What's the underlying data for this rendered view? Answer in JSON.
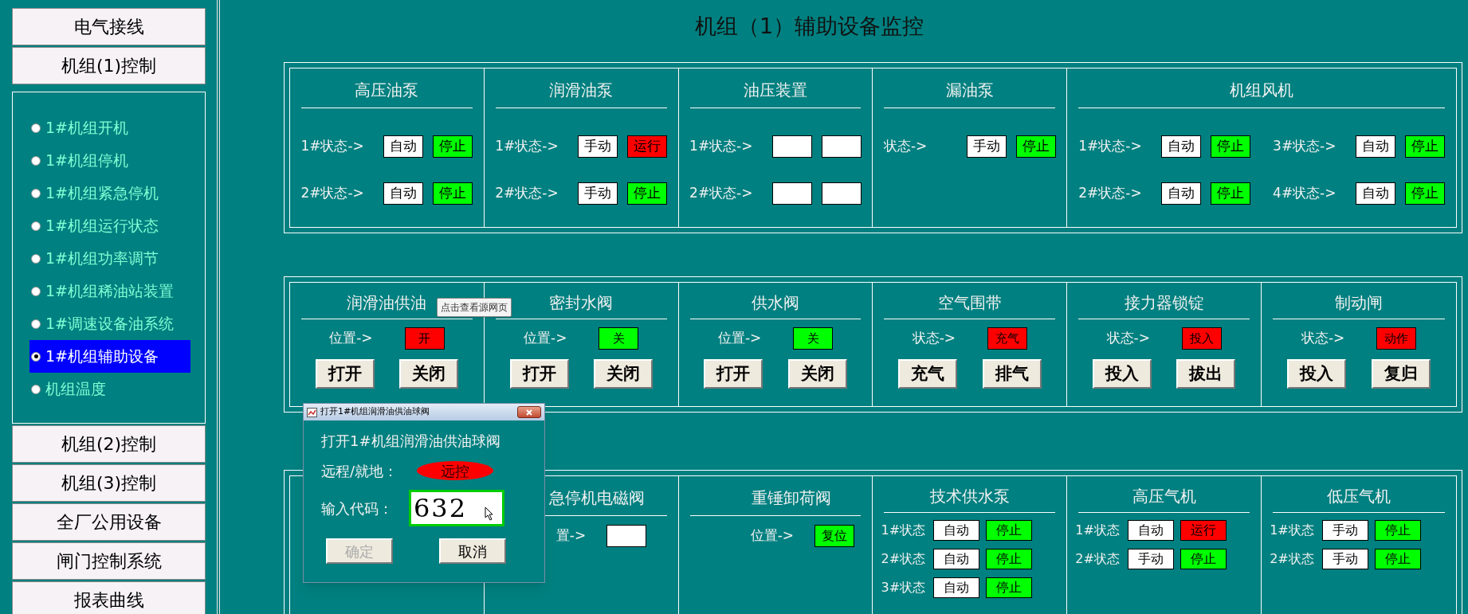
{
  "sidebar": {
    "top_buttons": [
      "电气接线",
      "机组(1)控制"
    ],
    "items": [
      {
        "label": "1#机组开机",
        "selected": false
      },
      {
        "label": "1#机组停机",
        "selected": false
      },
      {
        "label": "1#机组紧急停机",
        "selected": false
      },
      {
        "label": "1#机组运行状态",
        "selected": false
      },
      {
        "label": "1#机组功率调节",
        "selected": false
      },
      {
        "label": "1#机组稀油站装置",
        "selected": false
      },
      {
        "label": "1#调速设备油系统",
        "selected": false
      },
      {
        "label": "1#机组辅助设备",
        "selected": true
      },
      {
        "label": "机组温度",
        "selected": false
      }
    ],
    "bottom_buttons": [
      "机组(2)控制",
      "机组(3)控制",
      "全厂公用设备",
      "闸门控制系统",
      "报表曲线"
    ]
  },
  "title": "机组（1）辅助设备监控",
  "panels": [
    {
      "cells": [
        {
          "kind": "status",
          "header": "高压油泵",
          "rows": [
            {
              "label": "1#状态->",
              "mode": {
                "text": "自动",
                "color": "#ffffff"
              },
              "state": {
                "text": "停止",
                "color": "#00ff00"
              }
            },
            {
              "label": "2#状态->",
              "mode": {
                "text": "自动",
                "color": "#ffffff"
              },
              "state": {
                "text": "停止",
                "color": "#00ff00"
              }
            }
          ]
        },
        {
          "kind": "status",
          "header": "润滑油泵",
          "rows": [
            {
              "label": "1#状态->",
              "mode": {
                "text": "手动",
                "color": "#ffffff"
              },
              "state": {
                "text": "运行",
                "color": "#ff0000"
              }
            },
            {
              "label": "2#状态->",
              "mode": {
                "text": "手动",
                "color": "#ffffff"
              },
              "state": {
                "text": "停止",
                "color": "#00ff00"
              }
            }
          ]
        },
        {
          "kind": "status",
          "header": "油压装置",
          "rows": [
            {
              "label": "1#状态->",
              "mode": {
                "color": "#ffffff"
              },
              "state": {
                "color": "#ffffff"
              }
            },
            {
              "label": "2#状态->",
              "mode": {
                "color": "#ffffff"
              },
              "state": {
                "color": "#ffffff"
              }
            }
          ]
        },
        {
          "kind": "status",
          "header": "漏油泵",
          "rows": [
            {
              "label": "状态->",
              "mode": {
                "text": "手动",
                "color": "#ffffff"
              },
              "state": {
                "text": "停止",
                "color": "#00ff00"
              }
            }
          ]
        },
        {
          "kind": "status-wide",
          "header": "机组风机",
          "rows": [
            {
              "label": "1#状态->",
              "mode": {
                "text": "自动",
                "color": "#ffffff"
              },
              "state": {
                "text": "停止",
                "color": "#00ff00"
              }
            },
            {
              "label": "3#状态->",
              "mode": {
                "text": "自动",
                "color": "#ffffff"
              },
              "state": {
                "text": "停止",
                "color": "#00ff00"
              }
            },
            {
              "label": "2#状态->",
              "mode": {
                "text": "自动",
                "color": "#ffffff"
              },
              "state": {
                "text": "停止",
                "color": "#00ff00"
              }
            },
            {
              "label": "4#状态->",
              "mode": {
                "text": "自动",
                "color": "#ffffff"
              },
              "state": {
                "text": "停止",
                "color": "#00ff00"
              }
            }
          ]
        }
      ]
    },
    {
      "cells": [
        {
          "kind": "valve",
          "header": "润滑油供油",
          "label": "位置->",
          "indicator": {
            "text": "开",
            "color": "#ff0000"
          },
          "buttons": [
            "打开",
            "关闭"
          ]
        },
        {
          "kind": "valve",
          "header": "密封水阀",
          "label": "位置->",
          "indicator": {
            "text": "关",
            "color": "#00ff00"
          },
          "buttons": [
            "打开",
            "关闭"
          ]
        },
        {
          "kind": "valve",
          "header": "供水阀",
          "label": "位置->",
          "indicator": {
            "text": "关",
            "color": "#00ff00"
          },
          "buttons": [
            "打开",
            "关闭"
          ]
        },
        {
          "kind": "valve",
          "header": "空气围带",
          "label": "状态->",
          "indicator": {
            "text": "充气",
            "color": "#ff0000"
          },
          "buttons": [
            "充气",
            "排气"
          ]
        },
        {
          "kind": "valve",
          "header": "接力器锁锭",
          "label": "状态->",
          "indicator": {
            "text": "投入",
            "color": "#ff0000"
          },
          "buttons": [
            "投入",
            "拔出"
          ]
        },
        {
          "kind": "valve",
          "header": "制动闸",
          "label": "状态->",
          "indicator": {
            "text": "动作",
            "color": "#ff0000"
          },
          "buttons": [
            "投入",
            "复归"
          ]
        }
      ]
    },
    {
      "cells": [
        {
          "kind": "blank"
        },
        {
          "kind": "position",
          "header": "急停机电磁阀",
          "label": "置->",
          "indicator": {
            "color": "#ffffff"
          }
        },
        {
          "kind": "position",
          "header": "重锤卸荷阀",
          "label": "位置->",
          "indicator": {
            "text": "复位",
            "color": "#00ff00"
          }
        },
        {
          "kind": "compact",
          "header": "技术供水泵",
          "rows": [
            {
              "label": "1#状态",
              "mode": {
                "text": "自动",
                "color": "#ffffff"
              },
              "state": {
                "text": "停止",
                "color": "#00ff00"
              }
            },
            {
              "label": "2#状态",
              "mode": {
                "text": "自动",
                "color": "#ffffff"
              },
              "state": {
                "text": "停止",
                "color": "#00ff00"
              }
            },
            {
              "label": "3#状态",
              "mode": {
                "text": "自动",
                "color": "#ffffff"
              },
              "state": {
                "text": "停止",
                "color": "#00ff00"
              }
            }
          ]
        },
        {
          "kind": "compact",
          "header": "高压气机",
          "rows": [
            {
              "label": "1#状态",
              "mode": {
                "text": "自动",
                "color": "#ffffff"
              },
              "state": {
                "text": "运行",
                "color": "#ff0000"
              }
            },
            {
              "label": "2#状态",
              "mode": {
                "text": "手动",
                "color": "#ffffff"
              },
              "state": {
                "text": "停止",
                "color": "#00ff00"
              }
            }
          ]
        },
        {
          "kind": "compact",
          "header": "低压气机",
          "rows": [
            {
              "label": "1#状态",
              "mode": {
                "text": "手动",
                "color": "#ffffff"
              },
              "state": {
                "text": "停止",
                "color": "#00ff00"
              }
            },
            {
              "label": "2#状态",
              "mode": {
                "text": "手动",
                "color": "#ffffff"
              },
              "state": {
                "text": "停止",
                "color": "#00ff00"
              }
            }
          ]
        }
      ]
    }
  ],
  "tooltip": "点击查看源网页",
  "dialog": {
    "title": "打开1#机组润滑油供油球阀",
    "heading": "打开1#机组润滑油供油球阀",
    "remote_label": "远程/就地：",
    "remote_value": "远控",
    "code_label": "输入代码：",
    "code_value": "632",
    "buttons": [
      {
        "label": "确定",
        "disabled": true
      },
      {
        "label": "取消",
        "disabled": false
      }
    ]
  }
}
